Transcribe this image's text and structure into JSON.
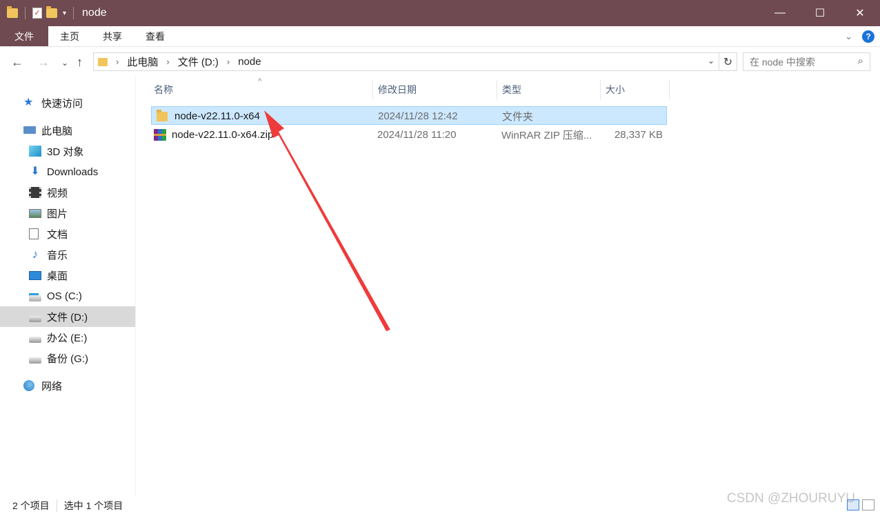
{
  "window": {
    "title": "node",
    "controls": {
      "minimize": "—",
      "maximize": "☐",
      "close": "✕"
    }
  },
  "ribbon": {
    "tabs": [
      "文件",
      "主页",
      "共享",
      "查看"
    ]
  },
  "address": {
    "crumbs": [
      "此电脑",
      "文件 (D:)",
      "node"
    ],
    "search_placeholder": "在 node 中搜索"
  },
  "sidebar": {
    "items": [
      {
        "label": "快速访问",
        "icon": "star-icon"
      },
      {
        "label": "此电脑",
        "icon": "computer-icon"
      },
      {
        "label": "3D 对象",
        "icon": "cube-icon"
      },
      {
        "label": "Downloads",
        "icon": "download-icon"
      },
      {
        "label": "视频",
        "icon": "video-icon"
      },
      {
        "label": "图片",
        "icon": "picture-icon"
      },
      {
        "label": "文档",
        "icon": "document-icon"
      },
      {
        "label": "音乐",
        "icon": "music-icon"
      },
      {
        "label": "桌面",
        "icon": "desktop-icon"
      },
      {
        "label": "OS (C:)",
        "icon": "drive-c-icon"
      },
      {
        "label": "文件 (D:)",
        "icon": "drive-icon",
        "selected": true
      },
      {
        "label": "办公 (E:)",
        "icon": "drive-icon"
      },
      {
        "label": "备份 (G:)",
        "icon": "drive-icon"
      },
      {
        "label": "网络",
        "icon": "network-icon"
      }
    ]
  },
  "columns": [
    "名称",
    "修改日期",
    "类型",
    "大小"
  ],
  "files": [
    {
      "name": "node-v22.11.0-x64",
      "date": "2024/11/28 12:42",
      "type": "文件夹",
      "size": "",
      "icon": "folder-icon",
      "selected": true
    },
    {
      "name": "node-v22.11.0-x64.zip",
      "date": "2024/11/28 11:20",
      "type": "WinRAR ZIP 压缩...",
      "size": "28,337 KB",
      "icon": "winrar-icon",
      "selected": false
    }
  ],
  "status": {
    "count": "2 个项目",
    "selection": "选中 1 个项目"
  },
  "watermark": "CSDN @ZHOURUYU",
  "colors": {
    "titlebar": "#6f4a50",
    "selection": "#cce8ff",
    "arrow": "#ef3b3b"
  }
}
